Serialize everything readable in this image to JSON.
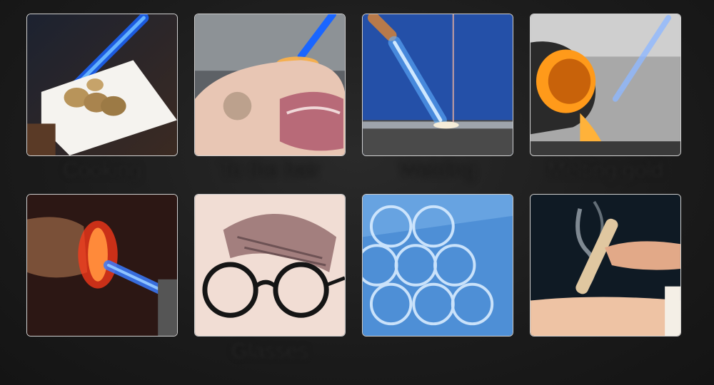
{
  "tiles": [
    {
      "id": "cooking",
      "image": "torch-cooking-shrimp",
      "caption": "Cooking"
    },
    {
      "id": "pork",
      "image": "torch-singeing-pork",
      "caption": "To the hair"
    },
    {
      "id": "welding",
      "image": "torch-welding-pipe",
      "caption": "Welding"
    },
    {
      "id": "melting",
      "image": "torch-melting-gold",
      "caption": "Melting gold"
    },
    {
      "id": "heating",
      "image": "torch-heating-pipe",
      "caption": ""
    },
    {
      "id": "glasses",
      "image": "eyeglasses",
      "caption": "Glasses"
    },
    {
      "id": "glass-tubes",
      "image": "glass-tubes",
      "caption": ""
    },
    {
      "id": "moxibustion",
      "image": "moxibustion",
      "caption": ""
    }
  ]
}
